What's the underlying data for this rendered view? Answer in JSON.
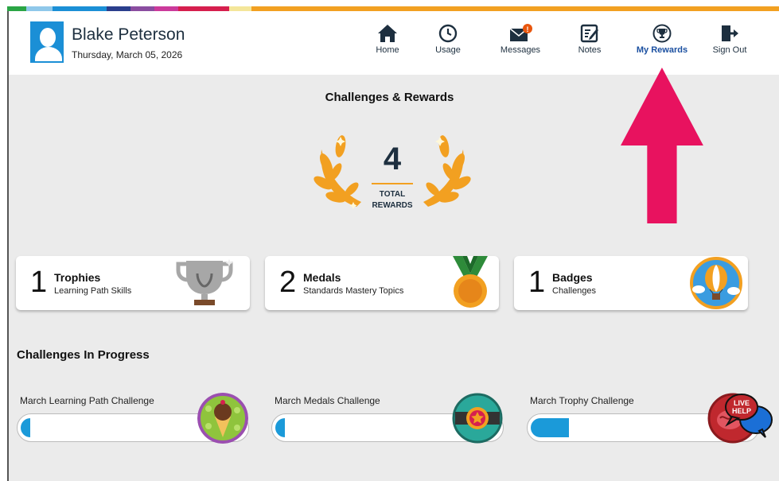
{
  "stripe_colors": [
    "#2aa545",
    "#8fc8ea",
    "#1b8fd6",
    "#2a3e8c",
    "#8a4da0",
    "#cb3a9b",
    "#d61f4e",
    "#f4e69a",
    "#f2a021"
  ],
  "header": {
    "user_name": "Blake Peterson",
    "date": "Thursday, March 05, 2026"
  },
  "nav": {
    "home": "Home",
    "usage": "Usage",
    "messages": "Messages",
    "notes": "Notes",
    "my_rewards": "My Rewards",
    "sign_out": "Sign Out"
  },
  "rewards": {
    "title": "Challenges & Rewards",
    "total_count": "4",
    "total_label_1": "TOTAL",
    "total_label_2": "REWARDS"
  },
  "cards": [
    {
      "count": "1",
      "title": "Trophies",
      "subtitle": "Learning Path Skills",
      "icon": "trophy-icon"
    },
    {
      "count": "2",
      "title": "Medals",
      "subtitle": "Standards Mastery Topics",
      "icon": "medal-icon"
    },
    {
      "count": "1",
      "title": "Badges",
      "subtitle": "Challenges",
      "icon": "hot-air-balloon-badge-icon"
    }
  ],
  "challenges": {
    "title": "Challenges In Progress",
    "items": [
      {
        "label": "March Learning Path Challenge",
        "progress": 0.04,
        "icon": "ice-cream-badge-icon"
      },
      {
        "label": "March Medals Challenge",
        "progress": 0.04,
        "icon": "star-belt-badge-icon"
      },
      {
        "label": "March Trophy Challenge",
        "progress": 0.17,
        "icon": "brain-badge-icon"
      }
    ]
  },
  "live_help": {
    "line1": "LIVE",
    "line2": "HELP"
  },
  "accent_color": "#1a4fa0",
  "arrow_color": "#e8125f"
}
